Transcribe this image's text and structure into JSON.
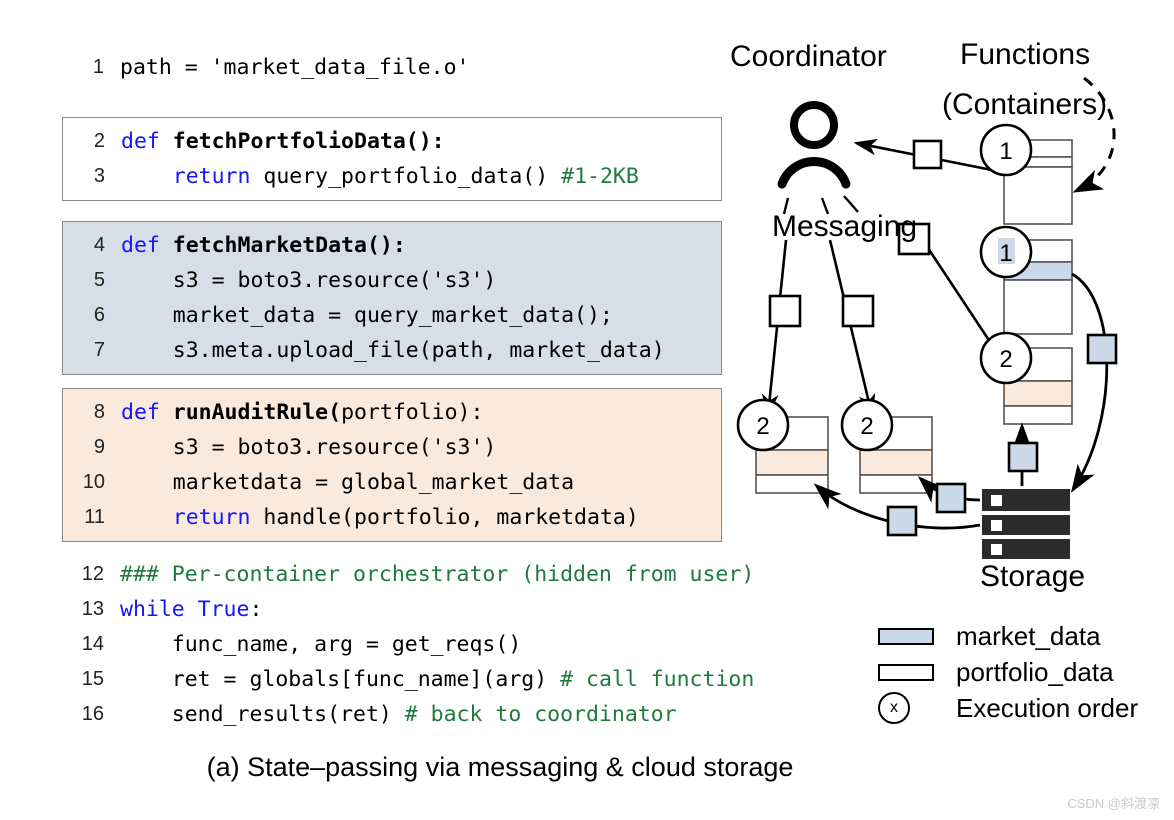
{
  "figure": {
    "caption": "(a) State–passing via messaging & cloud storage",
    "watermark": "CSDN @斜渡凛"
  },
  "code": {
    "blocks": [
      {
        "id": "block-intro",
        "style": "plain",
        "lines": [
          {
            "num": "1",
            "tokens": [
              {
                "t": "path = 'market_data_file.o'",
                "c": "plain"
              }
            ]
          }
        ]
      },
      {
        "id": "block-fetch-portfolio",
        "style": "white-boxed",
        "lines": [
          {
            "num": "2",
            "tokens": [
              {
                "t": "def ",
                "c": "kw"
              },
              {
                "t": "fetchPortfolioData():",
                "c": "fn"
              }
            ]
          },
          {
            "num": "3",
            "tokens": [
              {
                "t": "    ",
                "c": "plain"
              },
              {
                "t": "return",
                "c": "kw"
              },
              {
                "t": " query_portfolio_data() ",
                "c": "plain"
              },
              {
                "t": "#1-2KB",
                "c": "cmt"
              }
            ]
          }
        ]
      },
      {
        "id": "block-fetch-market",
        "style": "blue-boxed",
        "lines": [
          {
            "num": "4",
            "tokens": [
              {
                "t": "def ",
                "c": "kw"
              },
              {
                "t": "fetchMarketData():",
                "c": "fn"
              }
            ]
          },
          {
            "num": "5",
            "tokens": [
              {
                "t": "    s3 = boto3.resource('s3')",
                "c": "plain"
              }
            ]
          },
          {
            "num": "6",
            "tokens": [
              {
                "t": "    market_data = query_market_data();",
                "c": "plain"
              }
            ]
          },
          {
            "num": "7",
            "tokens": [
              {
                "t": "    s3.meta.upload_file(path, market_data)",
                "c": "plain"
              }
            ]
          }
        ]
      },
      {
        "id": "block-run-audit",
        "style": "peach-boxed",
        "lines": [
          {
            "num": "8",
            "tokens": [
              {
                "t": "def ",
                "c": "kw"
              },
              {
                "t": "runAuditRule(",
                "c": "fn"
              },
              {
                "t": "portfolio):",
                "c": "plain"
              }
            ]
          },
          {
            "num": "9",
            "tokens": [
              {
                "t": "    s3 = boto3.resource('s3')",
                "c": "plain"
              }
            ]
          },
          {
            "num": "10",
            "tokens": [
              {
                "t": "    marketdata = global_market_data",
                "c": "plain"
              }
            ]
          },
          {
            "num": "11",
            "tokens": [
              {
                "t": "    ",
                "c": "plain"
              },
              {
                "t": "return",
                "c": "kw"
              },
              {
                "t": " handle(portfolio, marketdata)",
                "c": "plain"
              }
            ]
          }
        ]
      },
      {
        "id": "block-orchestrator",
        "style": "plain",
        "lines": [
          {
            "num": "12",
            "tokens": [
              {
                "t": "### Per-container orchestrator (hidden from user)",
                "c": "cmt"
              }
            ]
          },
          {
            "num": "13",
            "tokens": [
              {
                "t": "while True",
                "c": "kw"
              },
              {
                "t": ":",
                "c": "plain"
              }
            ]
          },
          {
            "num": "14",
            "tokens": [
              {
                "t": "    func_name, arg = get_reqs()",
                "c": "plain"
              }
            ]
          },
          {
            "num": "15",
            "tokens": [
              {
                "t": "    ret = globals[func_name](arg) ",
                "c": "plain"
              },
              {
                "t": "# call function",
                "c": "cmt"
              }
            ]
          },
          {
            "num": "16",
            "tokens": [
              {
                "t": "    send_results(ret) ",
                "c": "plain"
              },
              {
                "t": "# back to coordinator",
                "c": "cmt"
              }
            ]
          }
        ]
      }
    ]
  },
  "diagram": {
    "labels": {
      "coordinator": "Coordinator",
      "functions_line1": "Functions",
      "functions_line2": "(Containers)",
      "messaging": "Messaging",
      "storage": "Storage"
    },
    "order_markers": [
      {
        "id": "marker-c1-top",
        "text": "1"
      },
      {
        "id": "marker-c2-mid",
        "text": "1"
      },
      {
        "id": "marker-c3-bot",
        "text": "2"
      },
      {
        "id": "marker-left-a",
        "text": "2"
      },
      {
        "id": "marker-left-b",
        "text": "2"
      }
    ]
  },
  "legend": {
    "rows": [
      {
        "id": "legend-market",
        "kind": "swatch-filled",
        "label": "market_data"
      },
      {
        "id": "legend-portfolio",
        "kind": "swatch-empty",
        "label": "portfolio_data"
      },
      {
        "id": "legend-order",
        "kind": "circle",
        "symbol": "x",
        "label": "Execution order"
      }
    ]
  },
  "colors": {
    "market_fill": "#ccd9e8",
    "portfolio_fill": "#faeade",
    "block_blue": "#d6dee8",
    "block_peach": "#faeade",
    "keyword": "#1414ff",
    "comment": "#1f7a3d",
    "storage_bar": "#2b2b2b"
  }
}
